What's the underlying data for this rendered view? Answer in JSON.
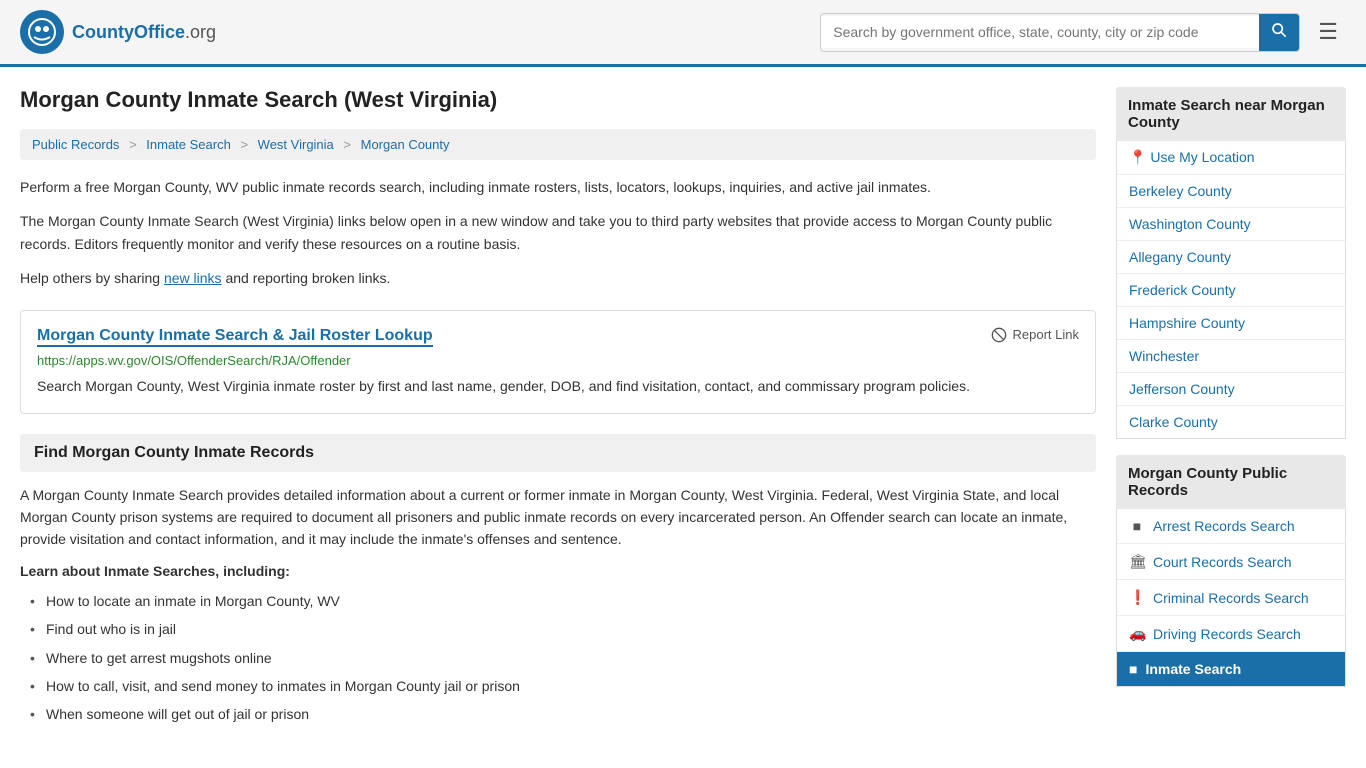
{
  "header": {
    "logo_text": "CountyOffice",
    "logo_suffix": ".org",
    "search_placeholder": "Search by government office, state, county, city or zip code",
    "search_value": ""
  },
  "page": {
    "title": "Morgan County Inmate Search (West Virginia)",
    "breadcrumbs": [
      {
        "label": "Public Records",
        "href": "#"
      },
      {
        "label": "Inmate Search",
        "href": "#"
      },
      {
        "label": "West Virginia",
        "href": "#"
      },
      {
        "label": "Morgan County",
        "href": "#"
      }
    ],
    "intro_1": "Perform a free Morgan County, WV public inmate records search, including inmate rosters, lists, locators, lookups, inquiries, and active jail inmates.",
    "intro_2": "The Morgan County Inmate Search (West Virginia) links below open in a new window and take you to third party websites that provide access to Morgan County public records. Editors frequently monitor and verify these resources on a routine basis.",
    "intro_3_before": "Help others by sharing ",
    "intro_3_link": "new links",
    "intro_3_after": " and reporting broken links.",
    "link_card": {
      "title": "Morgan County Inmate Search & Jail Roster Lookup",
      "url": "https://apps.wv.gov/OIS/OffenderSearch/RJA/Offender",
      "description": "Search Morgan County, West Virginia inmate roster by first and last name, gender, DOB, and find visitation, contact, and commissary program policies.",
      "report_label": "Report Link"
    },
    "find_section": {
      "heading": "Find Morgan County Inmate Records",
      "text": "A Morgan County Inmate Search provides detailed information about a current or former inmate in Morgan County, West Virginia. Federal, West Virginia State, and local Morgan County prison systems are required to document all prisoners and public inmate records on every incarcerated person. An Offender search can locate an inmate, provide visitation and contact information, and it may include the inmate's offenses and sentence."
    },
    "learn_heading": "Learn about Inmate Searches, including:",
    "bullet_items": [
      "How to locate an inmate in Morgan County, WV",
      "Find out who is in jail",
      "Where to get arrest mugshots online",
      "How to call, visit, and send money to inmates in Morgan County jail or prison",
      "When someone will get out of jail or prison"
    ]
  },
  "sidebar": {
    "nearby_heading": "Inmate Search near Morgan County",
    "use_location_label": "Use My Location",
    "nearby_links": [
      {
        "label": "Berkeley County",
        "href": "#"
      },
      {
        "label": "Washington County",
        "href": "#"
      },
      {
        "label": "Allegany County",
        "href": "#"
      },
      {
        "label": "Frederick County",
        "href": "#"
      },
      {
        "label": "Hampshire County",
        "href": "#"
      },
      {
        "label": "Winchester",
        "href": "#"
      },
      {
        "label": "Jefferson County",
        "href": "#"
      },
      {
        "label": "Clarke County",
        "href": "#"
      }
    ],
    "public_records_heading": "Morgan County Public Records",
    "public_links": [
      {
        "label": "Arrest Records Search",
        "icon": "■",
        "href": "#"
      },
      {
        "label": "Court Records Search",
        "icon": "🏛",
        "href": "#"
      },
      {
        "label": "Criminal Records Search",
        "icon": "❗",
        "href": "#"
      },
      {
        "label": "Driving Records Search",
        "icon": "🚗",
        "href": "#"
      },
      {
        "label": "Inmate Search",
        "icon": "■",
        "href": "#",
        "active": true
      }
    ]
  }
}
